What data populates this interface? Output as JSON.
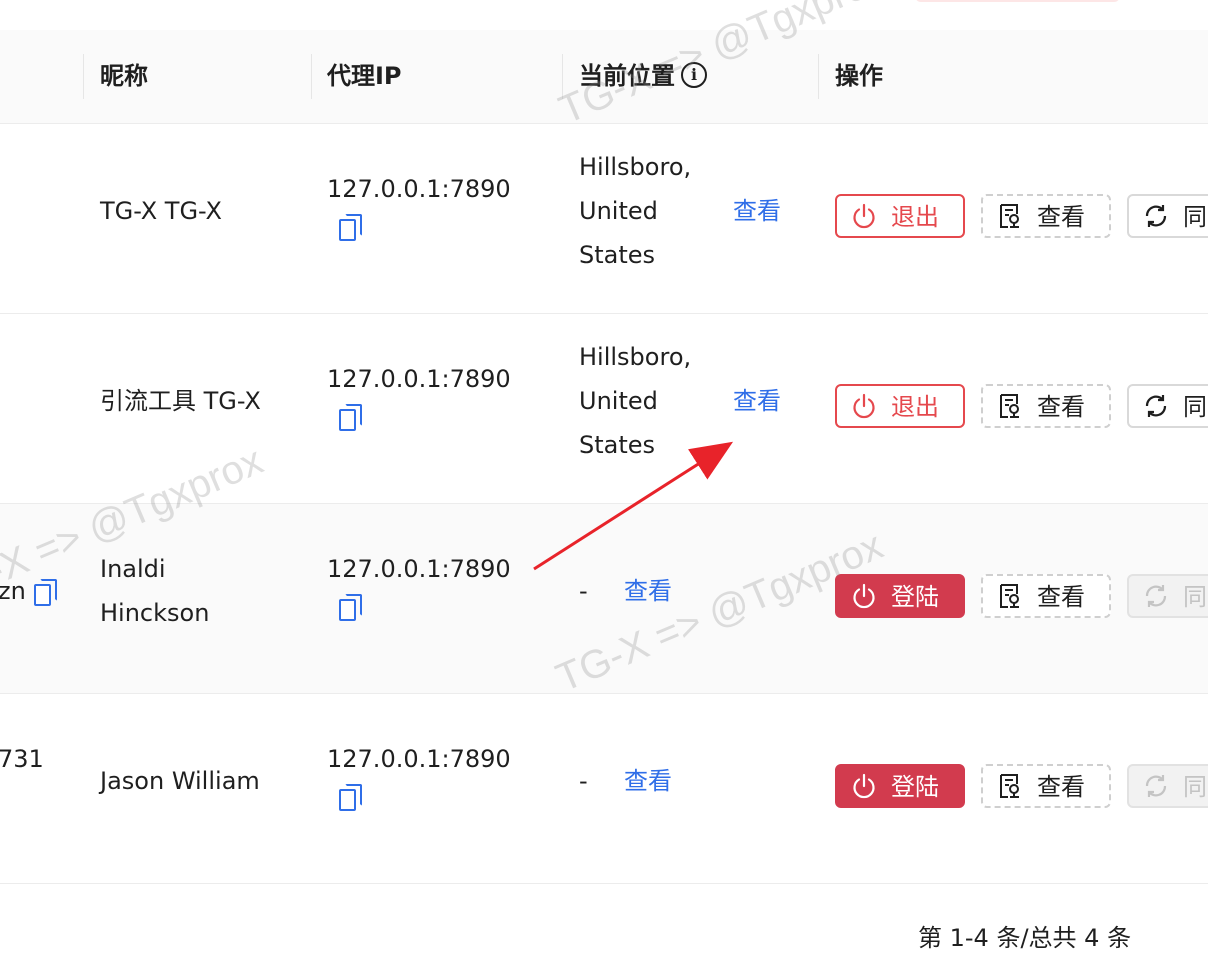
{
  "table": {
    "headers": {
      "nickname": "昵称",
      "proxy_ip": "代理IP",
      "location": "当前位置",
      "actions": "操作"
    },
    "rows": [
      {
        "left_fragment": "",
        "nickname": "TG-X TG-X",
        "proxy_ip": "127.0.0.1:7890",
        "location": "Hillsboro, United States",
        "view_link": "查看",
        "primary_action": "退出",
        "primary_type": "logout",
        "view_button": "查看",
        "sync_button": "同",
        "sync_disabled": false
      },
      {
        "left_fragment": "",
        "nickname": "引流工具 TG-X",
        "proxy_ip": "127.0.0.1:7890",
        "location": "Hillsboro, United States",
        "view_link": "查看",
        "primary_action": "退出",
        "primary_type": "logout",
        "view_button": "查看",
        "sync_button": "同",
        "sync_disabled": false
      },
      {
        "left_fragment": "zn",
        "nickname": "Inaldi Hinckson",
        "proxy_ip": "127.0.0.1:7890",
        "location": "-",
        "view_link": "查看",
        "primary_action": "登陆",
        "primary_type": "login",
        "view_button": "查看",
        "sync_button": "同",
        "sync_disabled": true
      },
      {
        "left_fragment": "731",
        "nickname": "Jason William",
        "proxy_ip": "127.0.0.1:7890",
        "location": "-",
        "view_link": "查看",
        "primary_action": "登陆",
        "primary_type": "login",
        "view_button": "查看",
        "sync_button": "同",
        "sync_disabled": true
      }
    ]
  },
  "pagination": {
    "summary": "第 1-4 条/总共 4 条"
  },
  "watermarks": [
    "TG-X => @Tgxprox",
    "TG-X => @Tgxprox",
    "TG-X => @Tgxprox"
  ],
  "colors": {
    "accent_link": "#2f6ee8",
    "logout_red": "#e5484d",
    "login_red": "#d23b4e",
    "annotation_arrow": "#e8232a"
  },
  "icons": {
    "info": "info-circle-icon",
    "copy": "copy-icon",
    "power": "power-icon",
    "view": "document-view-icon",
    "sync": "sync-icon"
  }
}
